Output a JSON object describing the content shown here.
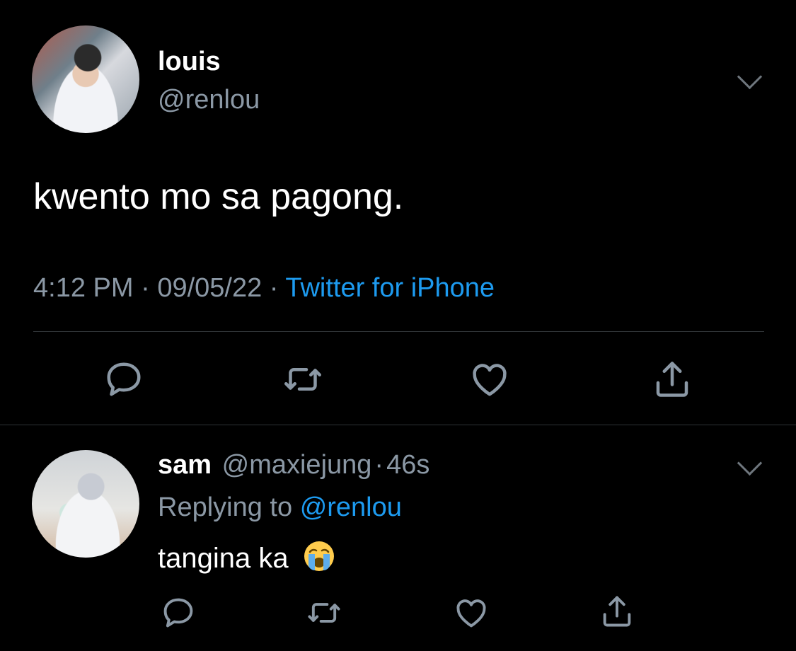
{
  "main_tweet": {
    "display_name": "louis",
    "handle": "@renlou",
    "text": "kwento mo sa pagong.",
    "time": "4:12 PM",
    "date": "09/05/22",
    "separator": "·",
    "source": "Twitter for iPhone"
  },
  "reply_tweet": {
    "display_name": "sam",
    "handle": "@maxiejung",
    "separator": "·",
    "age": "46s",
    "replying_prefix": "Replying to",
    "replying_to": "@renlou",
    "text": "tangina ka",
    "emoji": "loudly-crying-face"
  },
  "icons": {
    "reply": "reply-icon",
    "retweet": "retweet-icon",
    "like": "heart-icon",
    "share": "share-icon",
    "more": "chevron-down-icon"
  },
  "colors": {
    "background": "#000000",
    "text": "#ffffff",
    "secondary": "#8b98a5",
    "accent": "#1d9bf0",
    "divider": "#2f3336"
  }
}
